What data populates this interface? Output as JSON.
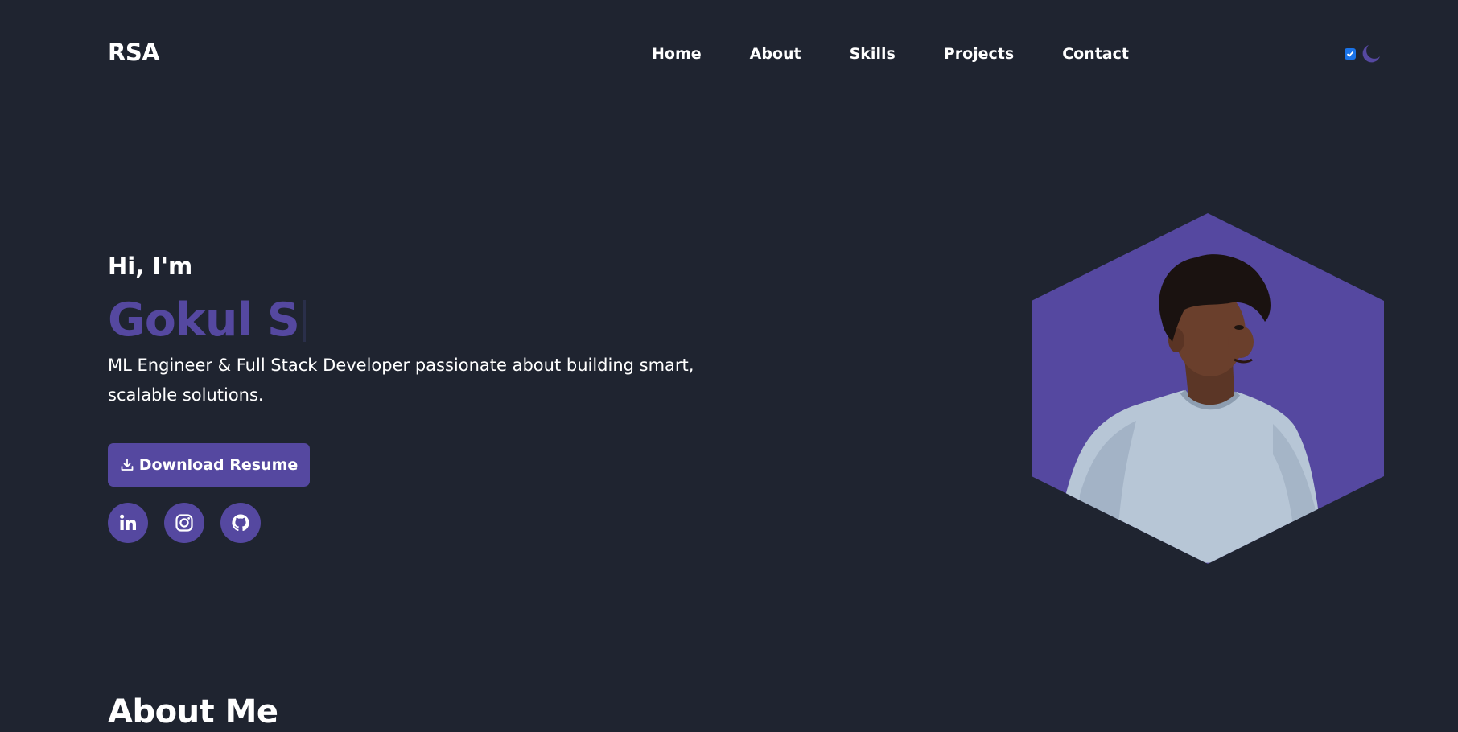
{
  "header": {
    "logo": "RSA",
    "nav": [
      "Home",
      "About",
      "Skills",
      "Projects",
      "Contact"
    ],
    "theme_toggle": {
      "checked": true,
      "icon": "moon-icon"
    }
  },
  "hero": {
    "greeting": "Hi, I'm",
    "name": "Gokul S",
    "description": "ML Engineer & Full Stack Developer passionate about building smart, scalable solutions.",
    "resume_button": "Download Resume",
    "socials": [
      "linkedin-icon",
      "instagram-icon",
      "github-icon"
    ]
  },
  "about": {
    "title": "About Me"
  },
  "colors": {
    "background": "#1f2430",
    "accent": "#5548a0",
    "text": "#ffffff"
  }
}
